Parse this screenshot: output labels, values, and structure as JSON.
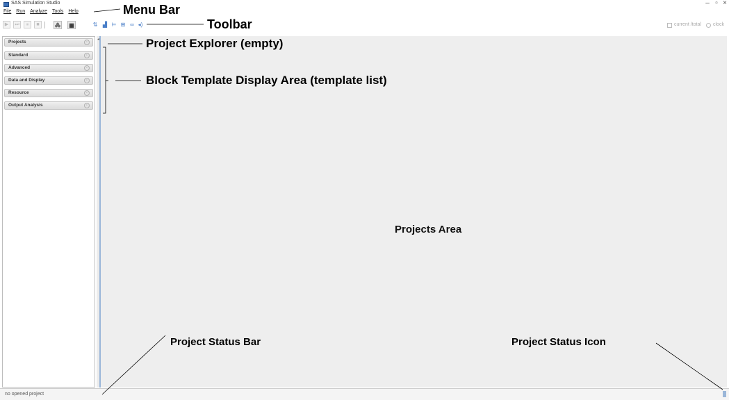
{
  "window": {
    "title": "SAS Simulation Studio",
    "controls": {
      "minimize": "–",
      "maximize": "▫",
      "close": "×"
    }
  },
  "menubar": {
    "items": [
      "File",
      "Run",
      "Analyze",
      "Tools",
      "Help"
    ]
  },
  "toolbar": {
    "run_buttons": [
      {
        "icon": "play-icon",
        "glyph": "▶"
      },
      {
        "icon": "step-icon",
        "glyph": "⏭"
      },
      {
        "icon": "pause-icon",
        "glyph": "⏸"
      },
      {
        "icon": "stop-icon",
        "glyph": "■"
      }
    ],
    "tool_buttons": [
      {
        "icon": "animate-icon",
        "glyph": "⁂"
      },
      {
        "icon": "grid-icon",
        "glyph": "▦"
      }
    ],
    "edit_icons": [
      {
        "icon": "align-icon",
        "glyph": "⇅"
      },
      {
        "icon": "chart-icon",
        "glyph": "▟"
      },
      {
        "icon": "distribute-icon",
        "glyph": "⊨"
      },
      {
        "icon": "table-icon",
        "glyph": "⊞"
      },
      {
        "icon": "link-icon",
        "glyph": "∞"
      },
      {
        "icon": "sound-icon",
        "glyph": "◂)"
      }
    ],
    "status_current_total": "current /total",
    "status_clock": "clock"
  },
  "explorer": {
    "sections": [
      {
        "label": "Projects"
      },
      {
        "label": "Standard"
      },
      {
        "label": "Advanced"
      },
      {
        "label": "Data and Display"
      },
      {
        "label": "Resource"
      },
      {
        "label": "Output Analysis"
      }
    ]
  },
  "status_bar": {
    "text": "no opened project"
  },
  "annotations": {
    "menu_bar": "Menu Bar",
    "toolbar": "Toolbar",
    "project_explorer": "Project Explorer (empty)",
    "block_template": "Block Template Display Area (template list)",
    "projects_area": "Projects Area",
    "project_status_bar": "Project Status Bar",
    "project_status_icon": "Project Status Icon"
  },
  "colors": {
    "accent_blue": "#9ab6d8",
    "projects_area_bg": "#eeeeee"
  }
}
